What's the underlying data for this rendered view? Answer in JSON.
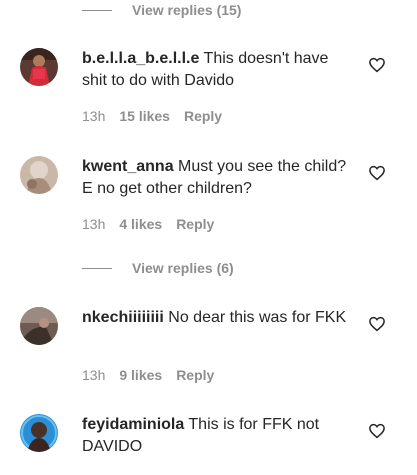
{
  "view_replies_1": {
    "label": "View replies (15)"
  },
  "view_replies_2": {
    "label": "View replies (6)"
  },
  "comments": [
    {
      "username": "b.e.l.l.a_b.e.l.l.e",
      "text": "This doesn't have shit to do with Davido",
      "time": "13h",
      "likes": "15 likes",
      "reply": "Reply",
      "avatar_icon": "avatar-photo"
    },
    {
      "username": "kwent_anna",
      "text": "Must you see the child? E no get other children?",
      "time": "13h",
      "likes": "4 likes",
      "reply": "Reply",
      "avatar_icon": "avatar-photo"
    },
    {
      "username": "nkechiiiiiiii",
      "text": "No dear this was for FKK",
      "time": "13h",
      "likes": "9 likes",
      "reply": "Reply",
      "avatar_icon": "avatar-photo"
    },
    {
      "username": "feyidaminiola",
      "text": "This is for FFK not DAVIDO",
      "time": "",
      "likes": "",
      "reply": "",
      "avatar_icon": "avatar-photo"
    }
  ],
  "icons": {
    "like": "heart-icon"
  },
  "colors": {
    "text": "#262626",
    "secondary": "#8e8e8e",
    "background": "#ffffff"
  }
}
